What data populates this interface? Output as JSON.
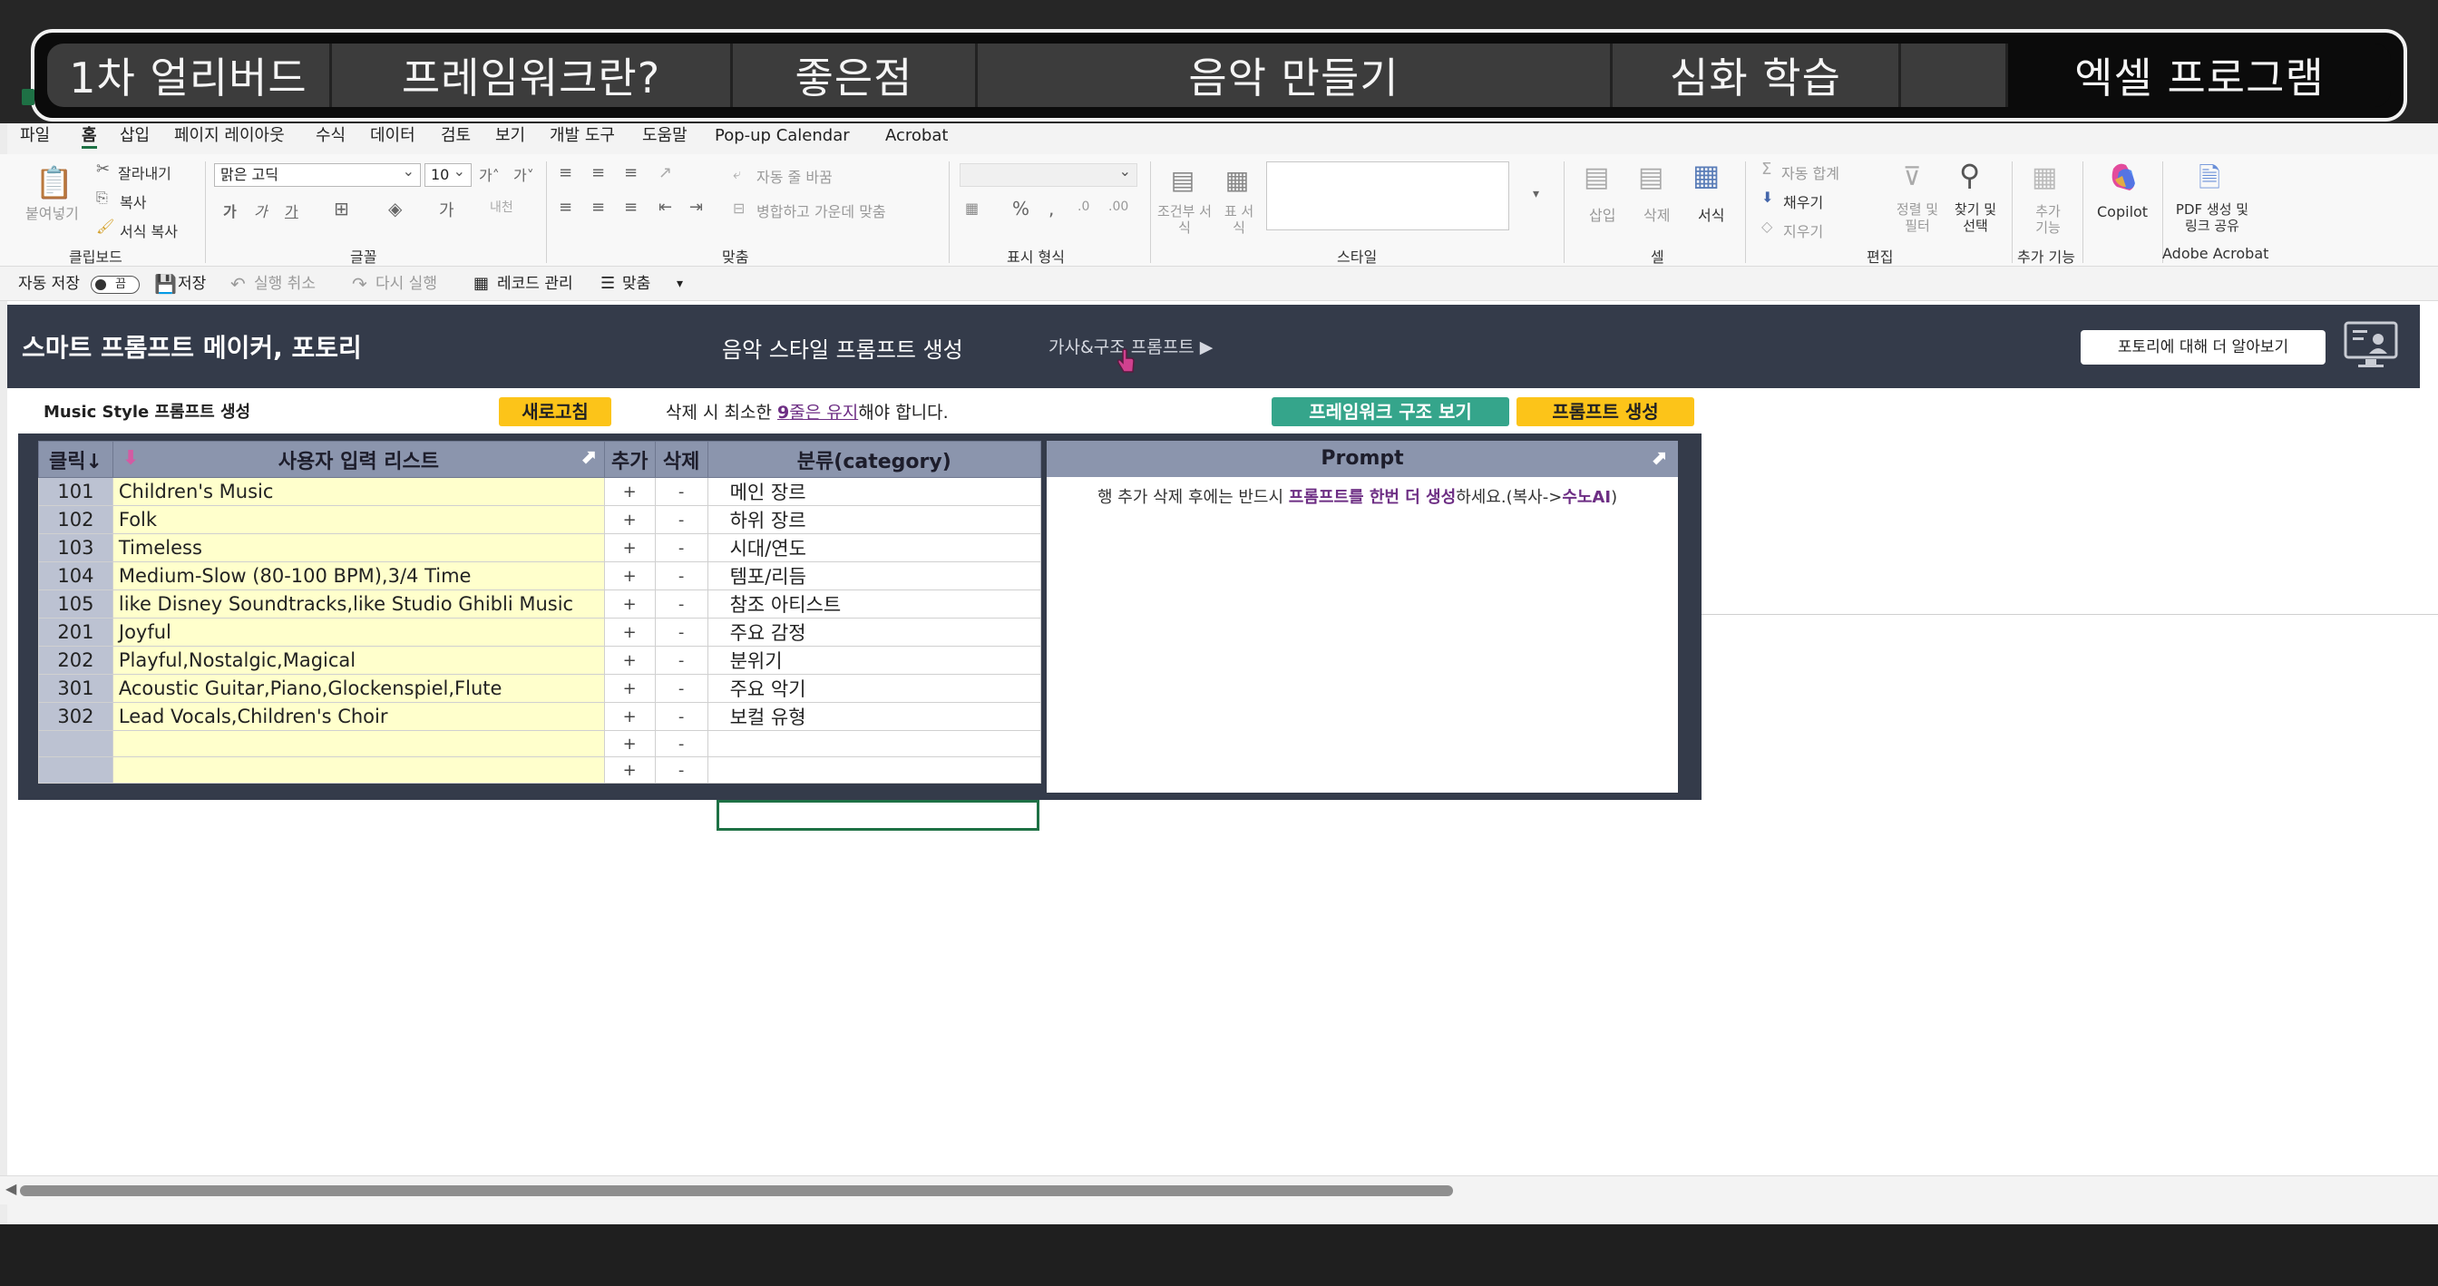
{
  "banner": {
    "tabs": [
      "1차 얼리버드",
      "프레임워크란?",
      "좋은점",
      "음악 만들기",
      "심화 학습",
      "",
      "엑셀 프로그램"
    ]
  },
  "menu": [
    "파일",
    "홈",
    "삽입",
    "페이지 레이아웃",
    "수식",
    "데이터",
    "검토",
    "보기",
    "개발 도구",
    "도움말",
    "Pop-up Calendar",
    "Acrobat"
  ],
  "ribbon": {
    "paste": "붙여넣기",
    "cut": "잘라내기",
    "copy": "복사",
    "format_painter": "서식 복사",
    "clipboard": "클립보드",
    "font_name": "맑은 고딕",
    "font_size": "10",
    "font": "글꼴",
    "wrap": "자동 줄 바꿈",
    "merge": "병합하고 가운데 맞춤",
    "alignment": "맞춤",
    "number_format": "표시 형식",
    "cond_format": "조건부 서식",
    "table_format": "표 서식",
    "styles": "스타일",
    "insert": "삽입",
    "delete": "삭제",
    "format": "서식",
    "cells": "셀",
    "autosum": "자동 합계",
    "fill": "채우기",
    "clear": "지우기",
    "sort": "정렬 및 필터",
    "find": "찾기 및 선택",
    "editing": "편집",
    "addins": "추가 기능",
    "addins_group": "추가 기능",
    "copilot": "Copilot",
    "pdf": "PDF 생성 및 링크 공유",
    "acrobat": "Adobe Acrobat"
  },
  "qat": {
    "autosave": "자동 저장",
    "toggle": "끔",
    "save": "저장",
    "undo": "실행 취소",
    "redo": "다시 실행",
    "record": "레코드 관리",
    "fit": "맞춤"
  },
  "app": {
    "title": "스마트 프롬프트 메이커, 포토리",
    "subtitle": "음악 스타일 프롬프트 생성",
    "link": "가사&구조 프롬프트 ▶",
    "more": "포토리에 대해 더 알아보기"
  },
  "controls": {
    "label": "Music Style 프롬프트 생성",
    "refresh": "새로고침",
    "warn_pre": "삭제 시 최소한 ",
    "warn_num": "9",
    "warn_mid": "줄은 유지",
    "warn_post": "해야 합니다.",
    "framework": "프레임워크 구조 보기",
    "generate": "프롬프트 생성"
  },
  "table": {
    "headers": [
      "클릭↓",
      "사용자 입력 리스트",
      "추가",
      "삭제",
      "분류(category)"
    ],
    "rows": [
      [
        "101",
        "Children's Music",
        "+",
        "-",
        "메인 장르"
      ],
      [
        "102",
        "Folk",
        "+",
        "-",
        "하위 장르"
      ],
      [
        "103",
        "Timeless",
        "+",
        "-",
        "시대/연도"
      ],
      [
        "104",
        "Medium-Slow (80-100 BPM),3/4 Time",
        "+",
        "-",
        "템포/리듬"
      ],
      [
        "105",
        "like Disney Soundtracks,like Studio Ghibli Music",
        "+",
        "-",
        "참조 아티스트"
      ],
      [
        "201",
        "Joyful",
        "+",
        "-",
        "주요 감정"
      ],
      [
        "202",
        "Playful,Nostalgic,Magical",
        "+",
        "-",
        "분위기"
      ],
      [
        "301",
        "Acoustic Guitar,Piano,Glockenspiel,Flute",
        "+",
        "-",
        "주요 악기"
      ],
      [
        "302",
        "Lead Vocals,Children's Choir",
        "+",
        "-",
        "보컬 유형"
      ],
      [
        "",
        "",
        "+",
        "-",
        ""
      ],
      [
        "",
        "",
        "+",
        "-",
        ""
      ]
    ]
  },
  "prompt": {
    "header": "Prompt",
    "msg_pre": "행 추가 삭제 후에는 반드시 ",
    "msg_hl": "프롬프트를 한번 더 생성",
    "msg_post": "하세요.(복사->",
    "msg_hl2": "수노AI",
    "msg_end": ")"
  },
  "colors": {
    "header_dark": "#343b4a",
    "header_table": "#8b95ad",
    "input_yellow": "#ffffcc",
    "button_yellow": "#fcc419",
    "button_green": "#35a58b",
    "excel_green": "#1e7145"
  }
}
